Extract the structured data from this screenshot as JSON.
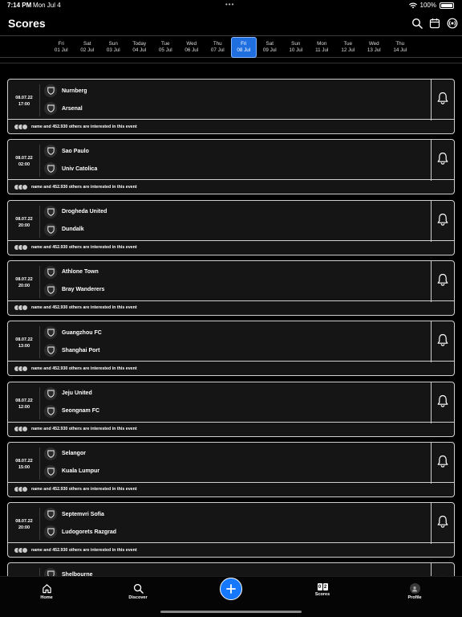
{
  "status_bar": {
    "time": "7:14 PM",
    "date": "Mon Jul 4",
    "battery": "100%"
  },
  "header": {
    "title": "Scores",
    "icons": [
      "search-icon",
      "calendar-icon",
      "live-icon"
    ]
  },
  "date_strip": {
    "selected_index": 7,
    "days": [
      {
        "day": "Fri",
        "date": "01 Jul"
      },
      {
        "day": "Sat",
        "date": "02 Jul"
      },
      {
        "day": "Sun",
        "date": "03 Jul"
      },
      {
        "day": "Today",
        "date": "04 Jul"
      },
      {
        "day": "Tue",
        "date": "05 Jul"
      },
      {
        "day": "Wed",
        "date": "06 Jul"
      },
      {
        "day": "Thu",
        "date": "07 Jul"
      },
      {
        "day": "Fri",
        "date": "08 Jul"
      },
      {
        "day": "Sat",
        "date": "09 Jul"
      },
      {
        "day": "Sun",
        "date": "10 Jul"
      },
      {
        "day": "Mon",
        "date": "11 Jul"
      },
      {
        "day": "Tue",
        "date": "12 Jul"
      },
      {
        "day": "Wed",
        "date": "13 Jul"
      },
      {
        "day": "Thu",
        "date": "14 Jul"
      }
    ]
  },
  "matches": [
    {
      "date": "08.07.22",
      "time": "17:00",
      "home": "Nurnberg",
      "away": "Arsenal",
      "interest": "name and 452.930 others are interested in this event"
    },
    {
      "date": "08.07.22",
      "time": "02:00",
      "home": "Sao Paulo",
      "away": "Univ Catolica",
      "interest": "name and 452.930 others are interested in this event"
    },
    {
      "date": "08.07.22",
      "time": "20:00",
      "home": "Drogheda United",
      "away": "Dundalk",
      "interest": "name and 452.930 others are interested in this event"
    },
    {
      "date": "08.07.22",
      "time": "20:00",
      "home": "Athlone Town",
      "away": "Bray Wanderers",
      "interest": "name and 452.930 others are interested in this event"
    },
    {
      "date": "08.07.22",
      "time": "13:00",
      "home": "Guangzhou FC",
      "away": "Shanghai Port",
      "interest": "name and 452.930 others are interested in this event"
    },
    {
      "date": "08.07.22",
      "time": "12:00",
      "home": "Jeju United",
      "away": "Seongnam FC",
      "interest": "name and 452.930 others are interested in this event"
    },
    {
      "date": "08.07.22",
      "time": "15:00",
      "home": "Selangor",
      "away": "Kuala Lumpur",
      "interest": "name and 452.930 others are interested in this event"
    },
    {
      "date": "08.07.22",
      "time": "20:00",
      "home": "Septemvri Sofia",
      "away": "Ludogorets Razgrad",
      "interest": "name and 452.930 others are interested in this event"
    },
    {
      "date": "",
      "time": "",
      "home": "Shelbourne",
      "away": "",
      "interest": ""
    }
  ],
  "tab_bar": {
    "home": "Home",
    "discover": "Discover",
    "scores": "Scores",
    "score_digits": [
      "0",
      "2"
    ],
    "profile": "Profile"
  },
  "colors": {
    "accent": "#1677ff",
    "background": "#000000",
    "card": "#151515"
  }
}
